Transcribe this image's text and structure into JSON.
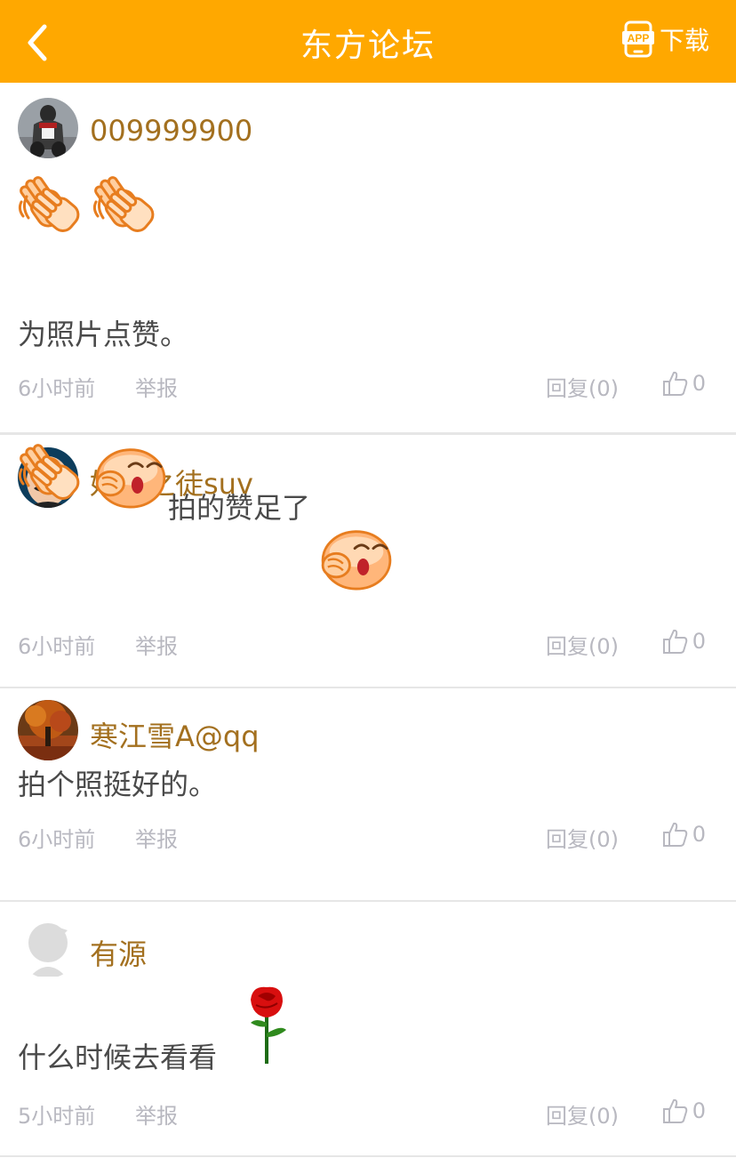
{
  "header": {
    "title": "东方论坛",
    "app_badge": "APP",
    "download_label": "下载",
    "background": "#ffa800"
  },
  "colors": {
    "username": "#a3701f",
    "meta": "#b8b8c0",
    "text": "#4a4a4a",
    "divider": "#e6e6e6"
  },
  "posts": [
    {
      "username": "009999900",
      "emojis": [
        "clapping-hands",
        "clapping-hands"
      ],
      "text": "为照片点赞。",
      "time": "6小时前",
      "report": "举报",
      "reply": "回复(0)",
      "likes": "0"
    },
    {
      "username": "好摄之徒suv",
      "emojis": [
        "clapping-hands",
        "yawning-face",
        "yawning-face"
      ],
      "text": "拍的赞足了",
      "time": "6小时前",
      "report": "举报",
      "reply": "回复(0)",
      "likes": "0"
    },
    {
      "username": "寒江雪A@qq",
      "text": "拍个照挺好的。",
      "time": "6小时前",
      "report": "举报",
      "reply": "回复(0)",
      "likes": "0"
    },
    {
      "username": "有源",
      "emojis": [
        "rose"
      ],
      "text": "什么时候去看看",
      "time": "5小时前",
      "report": "举报",
      "reply": "回复(0)",
      "likes": "0"
    }
  ]
}
